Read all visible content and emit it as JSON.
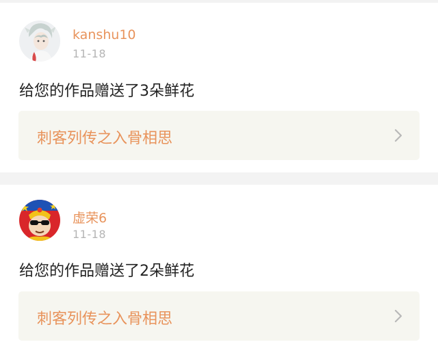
{
  "feed": {
    "items": [
      {
        "username": "kanshu10",
        "date": "11-18",
        "message": "给您的作品赠送了3朵鲜花",
        "work_title": "刺客列传之入骨相思",
        "avatar_icon": "anime-character-avatar-icon"
      },
      {
        "username": "虚荣6",
        "date": "11-18",
        "message": "给您的作品赠送了2朵鲜花",
        "work_title": "刺客列传之入骨相思",
        "avatar_icon": "cartoon-emperor-avatar-icon"
      }
    ]
  },
  "colors": {
    "accent": "#e8935b",
    "date": "#b5b5b5",
    "link_bg": "#f6f6f0",
    "separator": "#f3f3f3"
  }
}
